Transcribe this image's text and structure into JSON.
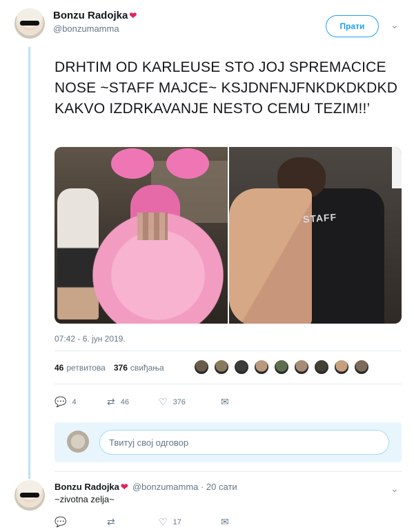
{
  "tweet": {
    "author_name": "Bonzu Radojka",
    "author_handle": "@bonzumamma",
    "follow_label": "Прати",
    "text": "DRHTIM OD KARLEUSE STO JOJ SPREMACICE NOSE ~STAFF MAJCE~ KSJDNFNJFNKDKDKDKD KAKVO IZDRKAVANJE NESTO CEMU TEZIM!!’",
    "photo_text": "STAFF",
    "timestamp": "07:42 - 6. јун 2019.",
    "retweets_count": "46",
    "retweets_label": "ретвитова",
    "likes_count": "376",
    "likes_label": "свиђања",
    "actions": {
      "reply": "4",
      "retweet": "46",
      "like": "376"
    }
  },
  "likers_colors": [
    "#6b5b4b",
    "#8a7a5c",
    "#3b3b3b",
    "#b99a7e",
    "#5c6f4e",
    "#a88b77",
    "#444036",
    "#c7a07f",
    "#7d6a58"
  ],
  "reply_box": {
    "placeholder": "Твитуј свој одговор"
  },
  "reply": {
    "author_name": "Bonzu Radojka",
    "meta": "@bonzumamma · 20 сати",
    "text": "~zivotna zelja~",
    "actions": {
      "reply": "",
      "retweet": "",
      "like": "17"
    }
  },
  "colors": {
    "accent": "#1da1f2",
    "heart": "#e0245e",
    "muted": "#657786",
    "thread_line": "#b9e3f7"
  }
}
